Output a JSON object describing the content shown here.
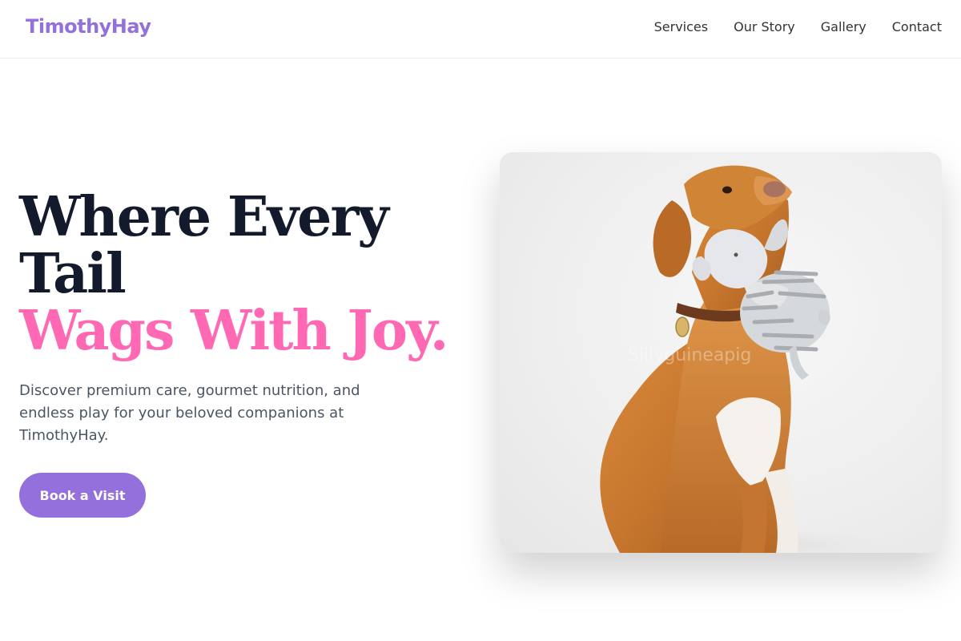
{
  "header": {
    "logo": "TimothyHay",
    "nav": [
      {
        "label": "Services"
      },
      {
        "label": "Our Story"
      },
      {
        "label": "Gallery"
      },
      {
        "label": "Contact"
      }
    ]
  },
  "hero": {
    "title_line1": "Where Every",
    "title_line2": "Tail",
    "title_line3": "Wags With Joy.",
    "description": "Discover premium care, gourmet nutrition, and endless play for your beloved companions at TimothyHay.",
    "cta_label": "Book a Visit",
    "image_alt": "Golden dog holding a striped plush elephant toy",
    "image_watermark": "Sillyguineapig"
  },
  "colors": {
    "brand": "#9370db",
    "accent": "#ff69b4",
    "heading": "#131a2b",
    "body_text": "#4b5563"
  }
}
